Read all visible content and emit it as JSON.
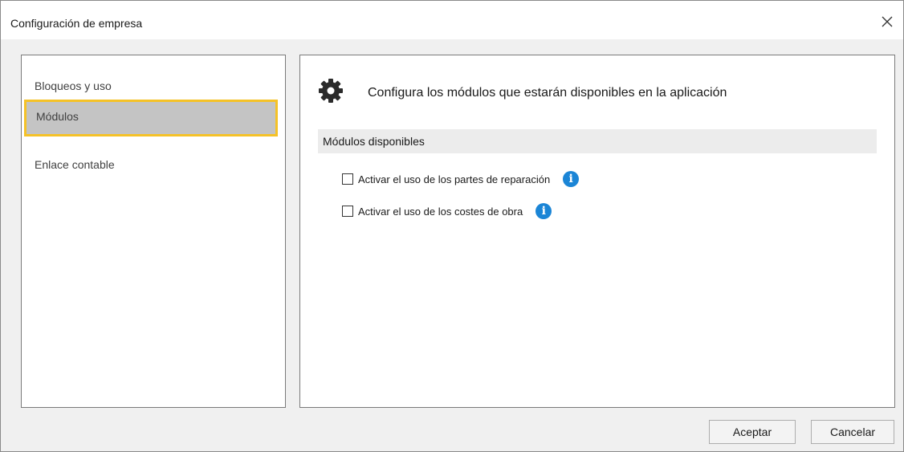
{
  "window": {
    "title": "Configuración de empresa",
    "close_icon": "close-icon"
  },
  "sidebar": {
    "items": [
      {
        "label": "Bloqueos y uso",
        "selected": false
      },
      {
        "label": "Módulos",
        "selected": true
      },
      {
        "label": "Enlace contable",
        "selected": false
      }
    ],
    "selected_highlight_color": "#f5c227"
  },
  "main": {
    "icon": "gear-icon",
    "heading": "Configura los módulos que estarán disponibles en la aplicación",
    "section_title": "Módulos disponibles",
    "options": [
      {
        "label": "Activar el uso de los partes de reparación",
        "checked": false,
        "info_icon": "info-icon"
      },
      {
        "label": "Activar el uso de los costes de obra",
        "checked": false,
        "info_icon": "info-icon"
      }
    ],
    "info_icon_color": "#1b85d6"
  },
  "footer": {
    "accept_label": "Aceptar",
    "cancel_label": "Cancelar"
  }
}
